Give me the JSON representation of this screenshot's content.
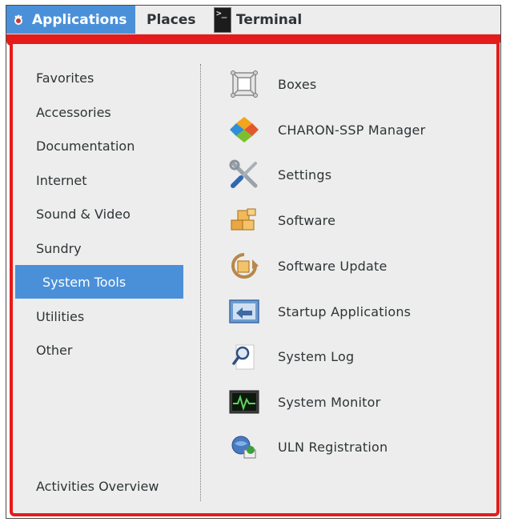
{
  "topbar": {
    "applications": "Applications",
    "places": "Places",
    "terminal": "Terminal"
  },
  "categories": [
    {
      "label": "Favorites",
      "selected": false
    },
    {
      "label": "Accessories",
      "selected": false
    },
    {
      "label": "Documentation",
      "selected": false
    },
    {
      "label": "Internet",
      "selected": false
    },
    {
      "label": "Sound & Video",
      "selected": false
    },
    {
      "label": "Sundry",
      "selected": false
    },
    {
      "label": "System Tools",
      "selected": true
    },
    {
      "label": "Utilities",
      "selected": false
    },
    {
      "label": "Other",
      "selected": false
    }
  ],
  "activities_overview": "Activities Overview",
  "apps": [
    {
      "label": "Boxes",
      "icon": "boxes-icon"
    },
    {
      "label": "CHARON-SSP Manager",
      "icon": "charon-icon"
    },
    {
      "label": "Settings",
      "icon": "settings-icon"
    },
    {
      "label": "Software",
      "icon": "software-icon"
    },
    {
      "label": "Software Update",
      "icon": "software-update-icon"
    },
    {
      "label": "Startup Applications",
      "icon": "startup-applications-icon"
    },
    {
      "label": "System Log",
      "icon": "system-log-icon"
    },
    {
      "label": "System Monitor",
      "icon": "system-monitor-icon"
    },
    {
      "label": "ULN Registration",
      "icon": "uln-registration-icon"
    }
  ],
  "colors": {
    "accent": "#4a90d9",
    "frame_red": "#e51b1b",
    "menu_bg": "#ededed",
    "text": "#2e3436"
  }
}
